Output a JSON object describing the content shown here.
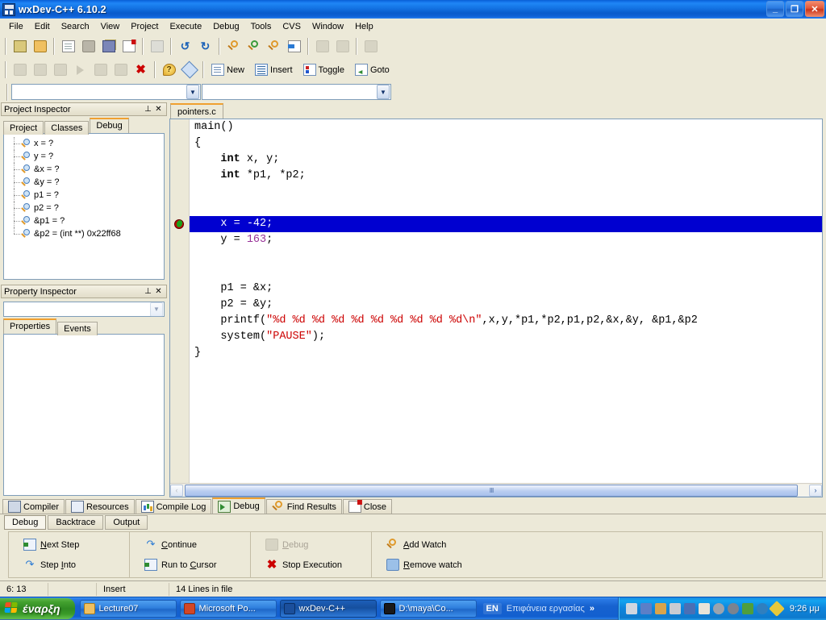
{
  "window": {
    "title": "wxDev-C++ 6.10.2",
    "icon": "devcpp-icon",
    "buttons": {
      "minimize": "_",
      "restore": "❐",
      "close": "✕"
    }
  },
  "menubar": {
    "items": [
      {
        "label": "File"
      },
      {
        "label": "Edit"
      },
      {
        "label": "Search"
      },
      {
        "label": "View"
      },
      {
        "label": "Project"
      },
      {
        "label": "Execute"
      },
      {
        "label": "Debug"
      },
      {
        "label": "Tools"
      },
      {
        "label": "CVS"
      },
      {
        "label": "Window"
      },
      {
        "label": "Help"
      }
    ]
  },
  "toolbar1": {
    "groups": [
      {
        "buttons": [
          {
            "name": "new-project-icon",
            "enabled": true
          },
          {
            "name": "open-folder-icon",
            "enabled": true
          }
        ]
      },
      {
        "buttons": [
          {
            "name": "new-file-icon",
            "enabled": true
          },
          {
            "name": "save-icon",
            "enabled": true
          },
          {
            "name": "save-all-icon",
            "enabled": true
          },
          {
            "name": "close-file-icon",
            "enabled": true
          }
        ]
      },
      {
        "buttons": [
          {
            "name": "print-icon",
            "enabled": false
          }
        ]
      },
      {
        "buttons": [
          {
            "name": "undo-icon",
            "enabled": true
          },
          {
            "name": "redo-icon",
            "enabled": true
          }
        ]
      },
      {
        "buttons": [
          {
            "name": "find-icon",
            "enabled": true
          },
          {
            "name": "replace-icon",
            "enabled": true
          },
          {
            "name": "find-next-icon",
            "enabled": true
          },
          {
            "name": "goto-line-icon",
            "enabled": true
          }
        ]
      },
      {
        "buttons": [
          {
            "name": "compile-icon",
            "enabled": false
          },
          {
            "name": "run-icon",
            "enabled": false
          }
        ]
      },
      {
        "buttons": [
          {
            "name": "compile-run-icon",
            "enabled": false
          }
        ]
      }
    ]
  },
  "toolbar2": {
    "groups": [
      {
        "buttons": [
          {
            "name": "compile-project-icon",
            "enabled": false
          },
          {
            "name": "build-icon",
            "enabled": false
          },
          {
            "name": "rebuild-all-icon",
            "enabled": false
          },
          {
            "name": "run-program-icon",
            "enabled": false
          },
          {
            "name": "compile-and-run-icon",
            "enabled": false
          },
          {
            "name": "debug-icon",
            "enabled": false
          },
          {
            "name": "stop-execution-icon",
            "enabled": true
          }
        ]
      },
      {
        "buttons": [
          {
            "name": "help-icon",
            "enabled": true
          },
          {
            "name": "about-icon",
            "enabled": true
          }
        ]
      }
    ],
    "text_buttons": [
      {
        "label": "New",
        "icon": "new-source-icon"
      },
      {
        "label": "Insert",
        "icon": "insert-snippet-icon"
      },
      {
        "label": "Toggle",
        "icon": "toggle-bookmark-icon"
      },
      {
        "label": "Goto",
        "icon": "goto-bookmark-icon"
      }
    ]
  },
  "combos": {
    "left": {
      "value": "",
      "placeholder": ""
    },
    "right": {
      "value": "",
      "placeholder": ""
    },
    "arrow_glyph": "▼"
  },
  "project_inspector": {
    "title": "Project Inspector",
    "pin_glyph": "⊥",
    "close_glyph": "✕",
    "tabs": [
      {
        "label": "Project",
        "active": false
      },
      {
        "label": "Classes",
        "active": false
      },
      {
        "label": "Debug",
        "active": true
      }
    ],
    "watches": [
      {
        "text": "x = ?"
      },
      {
        "text": "y = ?"
      },
      {
        "text": "&x = ?"
      },
      {
        "text": "&y = ?"
      },
      {
        "text": "p1 = ?"
      },
      {
        "text": "p2 = ?"
      },
      {
        "text": "&p1 = ?"
      },
      {
        "text": "&p2 = (int **) 0x22ff68"
      }
    ]
  },
  "property_inspector": {
    "title": "Property Inspector",
    "pin_glyph": "⊥",
    "close_glyph": "✕",
    "combo_value": "",
    "tabs": [
      {
        "label": "Properties",
        "active": true
      },
      {
        "label": "Events",
        "active": false
      }
    ]
  },
  "editor": {
    "tabs": [
      {
        "label": "pointers.c",
        "active": true
      }
    ],
    "breakpoint_line": 7,
    "highlighted_line": 7,
    "lines": [
      {
        "n": 1,
        "tokens": [
          {
            "t": "main()",
            "k": "plain"
          }
        ]
      },
      {
        "n": 2,
        "tokens": [
          {
            "t": "{",
            "k": "plain"
          }
        ]
      },
      {
        "n": 3,
        "tokens": [
          {
            "t": "    ",
            "k": "plain"
          },
          {
            "t": "int",
            "k": "kw"
          },
          {
            "t": " x, y;",
            "k": "plain"
          }
        ]
      },
      {
        "n": 4,
        "tokens": [
          {
            "t": "    ",
            "k": "plain"
          },
          {
            "t": "int",
            "k": "kw"
          },
          {
            "t": " *p1, *p2;",
            "k": "plain"
          }
        ]
      },
      {
        "n": 5,
        "tokens": [
          {
            "t": "",
            "k": "plain"
          }
        ]
      },
      {
        "n": 6,
        "tokens": [
          {
            "t": "",
            "k": "plain"
          }
        ]
      },
      {
        "n": 7,
        "tokens": [
          {
            "t": "    x = ",
            "k": "plain"
          },
          {
            "t": "-42",
            "k": "num"
          },
          {
            "t": ";",
            "k": "plain"
          }
        ],
        "highlight": true
      },
      {
        "n": 8,
        "tokens": [
          {
            "t": "    y = ",
            "k": "plain"
          },
          {
            "t": "163",
            "k": "num"
          },
          {
            "t": ";",
            "k": "plain"
          }
        ]
      },
      {
        "n": 9,
        "tokens": [
          {
            "t": "",
            "k": "plain"
          }
        ]
      },
      {
        "n": 10,
        "tokens": [
          {
            "t": "",
            "k": "plain"
          }
        ]
      },
      {
        "n": 11,
        "tokens": [
          {
            "t": "    p1 = &x;",
            "k": "plain"
          }
        ]
      },
      {
        "n": 12,
        "tokens": [
          {
            "t": "    p2 = &y;",
            "k": "plain"
          }
        ]
      },
      {
        "n": 13,
        "tokens": [
          {
            "t": "    printf(",
            "k": "plain"
          },
          {
            "t": "\"%d %d %d %d %d %d %d %d %d %d\\n\"",
            "k": "str"
          },
          {
            "t": ",x,y,*p1,*p2,p1,p2,&x,&y, &p1,&p2",
            "k": "plain"
          }
        ]
      },
      {
        "n": 14,
        "tokens": [
          {
            "t": "    system(",
            "k": "plain"
          },
          {
            "t": "\"PAUSE\"",
            "k": "str"
          },
          {
            "t": ");",
            "k": "plain"
          }
        ]
      },
      {
        "n": 15,
        "tokens": [
          {
            "t": "}",
            "k": "plain"
          }
        ]
      }
    ],
    "scrollbar": {
      "left_arrow": "‹",
      "right_arrow": "›",
      "grip": "‖‖"
    }
  },
  "bottom_panel": {
    "tabs": [
      {
        "label": "Compiler",
        "icon": "compiler-icon",
        "active": false
      },
      {
        "label": "Resources",
        "icon": "resources-icon",
        "active": false
      },
      {
        "label": "Compile Log",
        "icon": "compile-log-icon",
        "active": false
      },
      {
        "label": "Debug",
        "icon": "debug-icon",
        "active": true
      },
      {
        "label": "Find Results",
        "icon": "find-results-icon",
        "active": false
      },
      {
        "label": "Close",
        "icon": "close-panel-icon",
        "active": false
      }
    ],
    "sub_tabs": [
      {
        "label": "Debug",
        "active": true
      },
      {
        "label": "Backtrace",
        "active": false
      },
      {
        "label": "Output",
        "active": false
      }
    ],
    "debug_buttons": [
      [
        {
          "label": "Next Step",
          "accel": "N",
          "icon": "next-step-icon",
          "enabled": true
        },
        {
          "label": "Step Into",
          "accel": "I",
          "icon": "step-into-icon",
          "enabled": true
        }
      ],
      [
        {
          "label": "Continue",
          "accel": "C",
          "icon": "continue-icon",
          "enabled": true
        },
        {
          "label": "Run to Cursor",
          "accel": "C",
          "icon": "run-to-cursor-icon",
          "enabled": true
        }
      ],
      [
        {
          "label": "Debug",
          "accel": "D",
          "icon": "debug-run-icon",
          "enabled": false
        },
        {
          "label": "Stop Execution",
          "accel": "",
          "icon": "stop-execution-icon",
          "enabled": true
        }
      ],
      [
        {
          "label": "Add Watch",
          "accel": "A",
          "icon": "add-watch-icon",
          "enabled": true
        },
        {
          "label": "Remove watch",
          "accel": "R",
          "icon": "remove-watch-icon",
          "enabled": true
        }
      ]
    ]
  },
  "statusbar": {
    "cursor_position": "6: 13",
    "blank": "",
    "insert_mode": "Insert",
    "line_count": "14 Lines in file"
  },
  "taskbar": {
    "start_label": "έναρξη",
    "tasks": [
      {
        "label": "Lecture07",
        "icon": "folder-icon",
        "active": false,
        "color": "#f0c060"
      },
      {
        "label": "Microsoft Po...",
        "icon": "powerpoint-icon",
        "active": false,
        "color": "#d24726"
      },
      {
        "label": "wxDev-C++",
        "icon": "devcpp-icon",
        "active": true,
        "color": "#1b4f9c"
      },
      {
        "label": "D:\\maya\\Co...",
        "icon": "console-icon",
        "active": false,
        "color": "#1a1a1a"
      }
    ],
    "language": "EN",
    "desktop_bar_label": "Επιφάνεια εργασίας",
    "chevron": "»",
    "tray_icons": [
      {
        "name": "user-account-icon",
        "color": "#cfd6e0"
      },
      {
        "name": "network-icon",
        "color": "#5b7fc7"
      },
      {
        "name": "display-icon",
        "color": "#d8a44a"
      },
      {
        "name": "monitor-icon",
        "color": "#c9ccd2"
      },
      {
        "name": "binoculars-icon",
        "color": "#4a6fb5"
      },
      {
        "name": "volume-icon",
        "color": "#e8e4d8"
      },
      {
        "name": "webcam-icon",
        "color": "#9aa3ae"
      },
      {
        "name": "shield-icon",
        "color": "#7a8390"
      },
      {
        "name": "antivirus-icon",
        "color": "#4f9e3c"
      },
      {
        "name": "globe-icon",
        "color": "#2f7fbf"
      },
      {
        "name": "update-icon",
        "color": "#e8c83a"
      }
    ],
    "clock": "9:26 μμ"
  },
  "colors": {
    "titlebar_blue": "#1f86f5",
    "face": "#ece9d8",
    "tab_accent": "#f0a030",
    "highlight_bg": "#0000d0",
    "string_red": "#cc0000",
    "number_purple": "#993399"
  }
}
